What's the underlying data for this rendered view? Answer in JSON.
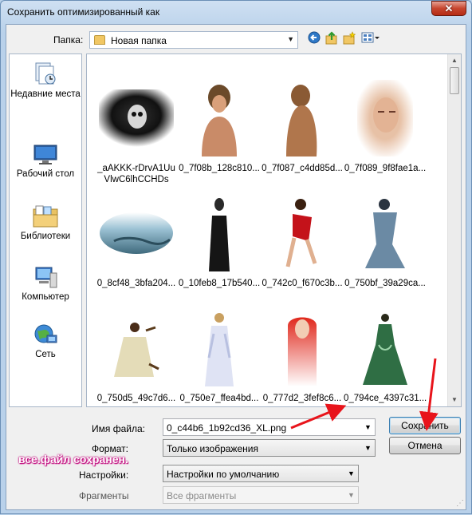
{
  "window": {
    "title": "Сохранить оптимизированный как",
    "close_glyph": "✕"
  },
  "toolbar": {
    "folder_label": "Папка:",
    "folder_value": "Новая папка",
    "icons": [
      "back-icon",
      "up-folder-icon",
      "new-folder-icon",
      "view-menu-icon"
    ]
  },
  "places": [
    {
      "label": "Недавние места",
      "icon": "recent-places-icon"
    },
    {
      "label": "Рабочий стол",
      "icon": "desktop-icon"
    },
    {
      "label": "Библиотеки",
      "icon": "libraries-icon"
    },
    {
      "label": "Компьютер",
      "icon": "computer-icon"
    },
    {
      "label": "Сеть",
      "icon": "network-icon"
    }
  ],
  "files": [
    {
      "name": "_aAKKK-rDrvA1Uu",
      "name2": "VlwC6lhCCHDs"
    },
    {
      "name": "0_7f08b_128c810...",
      "name2": ""
    },
    {
      "name": "0_7f087_c4dd85d...",
      "name2": ""
    },
    {
      "name": "0_7f089_9f8fae1a...",
      "name2": ""
    },
    {
      "name": "0_8cf48_3bfa204...",
      "name2": ""
    },
    {
      "name": "0_10feb8_17b540...",
      "name2": ""
    },
    {
      "name": "0_742c0_f670c3b...",
      "name2": ""
    },
    {
      "name": "0_750bf_39a29ca...",
      "name2": ""
    },
    {
      "name": "0_750d5_49c7d6...",
      "name2": ""
    },
    {
      "name": "0_750e7_ffea4bd...",
      "name2": ""
    },
    {
      "name": "0_777d2_3fef8c6...",
      "name2": ""
    },
    {
      "name": "0_794ce_4397c31...",
      "name2": ""
    }
  ],
  "form": {
    "filename_label": "Имя файла:",
    "filename_value": "0_c44b6_1b92cd36_XL.png",
    "format_label": "Формат:",
    "format_value": "Только изображения",
    "settings_label": "Настройки:",
    "settings_value": "Настройки по умолчанию",
    "fragments_label": "Фрагменты",
    "fragments_value": "Все фрагменты"
  },
  "buttons": {
    "save": "Сохранить",
    "cancel": "Отмена"
  },
  "annotation": "все.файл сохранен."
}
